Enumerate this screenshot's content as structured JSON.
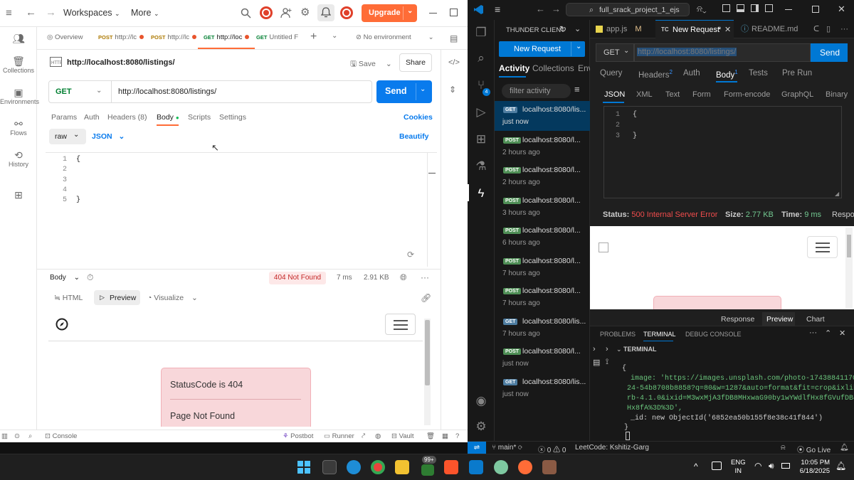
{
  "postman": {
    "top": {
      "workspaces": "Workspaces",
      "more": "More",
      "upgrade": "Upgrade"
    },
    "rail": [
      {
        "label": "Collections"
      },
      {
        "label": "Environments"
      },
      {
        "label": "Flows"
      },
      {
        "label": "History"
      }
    ],
    "tabs": [
      {
        "label": "Overview"
      },
      {
        "method": "POST",
        "label": "http://lc"
      },
      {
        "method": "POST",
        "label": "http://lc"
      },
      {
        "method": "GET",
        "label": "http://loc"
      },
      {
        "method": "GET",
        "label": "Untitled F"
      }
    ],
    "environment": "No environment",
    "request": {
      "title": "http://localhost:8080/listings/",
      "save": "Save",
      "share": "Share",
      "method": "GET",
      "url": "http://localhost:8080/listings/",
      "send": "Send"
    },
    "subtabs": {
      "params": "Params",
      "auth": "Auth",
      "headers": "Headers (8)",
      "body": "Body",
      "scripts": "Scripts",
      "settings": "Settings",
      "cookies": "Cookies"
    },
    "body_opts": {
      "raw": "raw",
      "json": "JSON",
      "beautify": "Beautify"
    },
    "editor": {
      "line_numbers": [
        "1",
        "2",
        "3",
        "4",
        "5"
      ],
      "lines": [
        "{",
        "",
        "",
        "",
        "}"
      ]
    },
    "response": {
      "body": "Body",
      "status": "404 Not Found",
      "time": "7 ms",
      "size": "2.91 KB",
      "html": "HTML",
      "preview": "Preview",
      "visualize": "Visualize",
      "card_title": "StatusCode is 404",
      "card_msg": "Page Not Found"
    },
    "bottom": {
      "console": "Console",
      "postbot": "Postbot",
      "runner": "Runner",
      "vault": "Vault"
    }
  },
  "vscode": {
    "search": "full_srack_project_1_ejs",
    "sidebar_title": "THUNDER CLIENT",
    "new_request": "New Request",
    "side_tabs": {
      "activity": "Activity",
      "collections": "Collections",
      "env": "Env"
    },
    "filter": "filter activity",
    "history": [
      {
        "method": "GET",
        "url": "localhost:8080/lis...",
        "time": "just now"
      },
      {
        "method": "POST",
        "url": "localhost:8080/l...",
        "time": "2 hours ago"
      },
      {
        "method": "POST",
        "url": "localhost:8080/l...",
        "time": "2 hours ago"
      },
      {
        "method": "POST",
        "url": "localhost:8080/l...",
        "time": "3 hours ago"
      },
      {
        "method": "POST",
        "url": "localhost:8080/l...",
        "time": "6 hours ago"
      },
      {
        "method": "POST",
        "url": "localhost:8080/l...",
        "time": "7 hours ago"
      },
      {
        "method": "POST",
        "url": "localhost:8080/l...",
        "time": "7 hours ago"
      },
      {
        "method": "GET",
        "url": "localhost:8080/lis...",
        "time": "7 hours ago"
      },
      {
        "method": "POST",
        "url": "localhost:8080/l...",
        "time": "just now"
      },
      {
        "method": "GET",
        "url": "localhost:8080/lis...",
        "time": "just now"
      }
    ],
    "editor_tabs": [
      {
        "label": "app.js",
        "badge": "M"
      },
      {
        "label": "New Request",
        "badge": "*"
      },
      {
        "label": "README.md",
        "badge": ""
      }
    ],
    "request": {
      "method": "GET",
      "url": "http://localhost:8080/listings/",
      "send": "Send"
    },
    "req_tabs": {
      "query": "Query",
      "headers": "Headers",
      "headers_count": "2",
      "auth": "Auth",
      "body": "Body",
      "body_count": "1",
      "tests": "Tests",
      "prerun": "Pre Run"
    },
    "body_types": [
      "JSON",
      "XML",
      "Text",
      "Form",
      "Form-encode",
      "GraphQL",
      "Binary"
    ],
    "editor": {
      "line_numbers": [
        "1",
        "2",
        "3"
      ],
      "lines": [
        "{",
        "",
        "}"
      ]
    },
    "status": {
      "status_label": "Status:",
      "status_value": "500 Internal Server Error",
      "size_label": "Size:",
      "size_value": "2.77 KB",
      "time_label": "Time:",
      "time_value": "9 ms",
      "resp": "Respo"
    },
    "resp_tabs": {
      "response": "Response",
      "preview": "Preview",
      "chart": "Chart"
    },
    "panel_tabs": {
      "problems": "PROBLEMS",
      "terminal": "TERMINAL",
      "debug": "DEBUG CONSOLE"
    },
    "terminal": {
      "header": "TERMINAL",
      "lines": [
        "{",
        "  image: 'https://images.unsplash.com/photo-17438841170",
        "24-54b8708b8858?q=80&w=1287&auto=format&fit=crop&ixlib=",
        "rb-4.1.0&ixid=M3wxMjA3fDB8MHxwaG90by1wYWdlfHx8fGVufDB8f",
        "Hx8fA%3D%3D',",
        "  _id: new ObjectId('6852ea50b155f8e38c41f844')",
        "}"
      ]
    },
    "statusbar": {
      "branch": "main*",
      "errors": "0",
      "warnings": "0",
      "leetcode": "LeetCode: Kshitiz-Garg",
      "golive": "Go Live"
    }
  },
  "taskbar": {
    "badge": "99+",
    "lang1": "ENG",
    "lang2": "IN",
    "time": "10:05 PM",
    "date": "6/18/2025"
  },
  "colors": {
    "send_blue": "#097bed",
    "upgrade": "#ff6c37",
    "tc_send": "#0078d4",
    "error_red": "#f14c4c",
    "ok_green": "#73c991"
  }
}
